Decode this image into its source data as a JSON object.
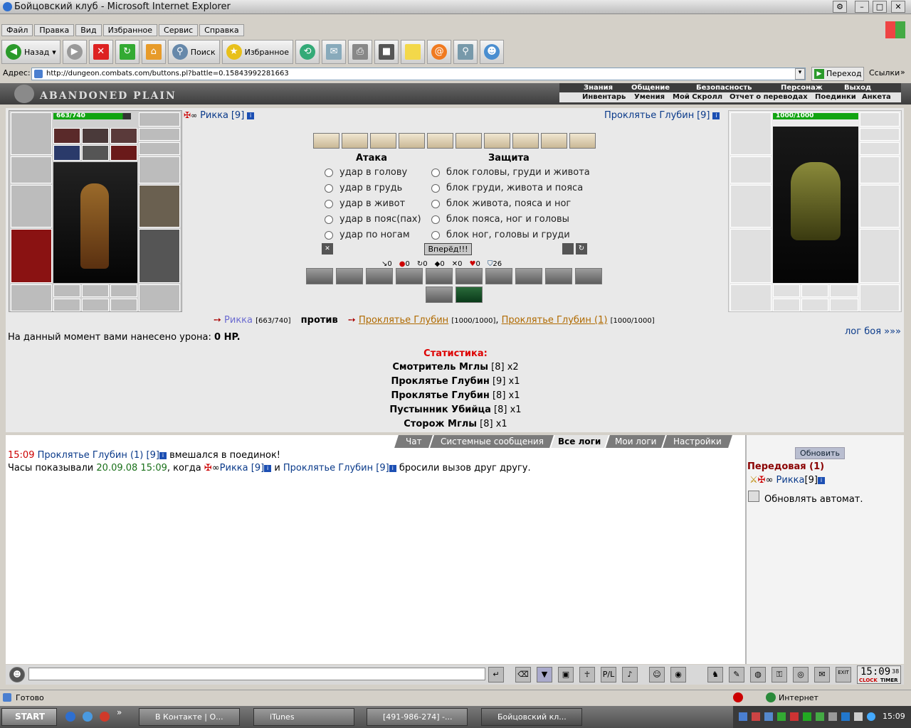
{
  "window": {
    "title": "Бойцовский клуб - Microsoft Internet Explorer"
  },
  "menu": [
    "Файл",
    "Правка",
    "Вид",
    "Избранное",
    "Сервис",
    "Справка"
  ],
  "toolbar": {
    "back": "Назад",
    "search": "Поиск",
    "favorites": "Избранное"
  },
  "address": {
    "label": "Адрес:",
    "url": "http://dungeon.combats.com/buttons.pl?battle=0.15843992281663",
    "go": "Переход",
    "links": "Ссылки"
  },
  "game_nav": {
    "location": "ABANDONED PLAIN",
    "top": [
      "Знания",
      "Общение",
      "Безопасность",
      "Персонаж",
      "Выход"
    ],
    "bottom": [
      "Инвентарь",
      "Умения",
      "Мой Скролл",
      "Отчет о переводах",
      "Поединки",
      "Анкета"
    ]
  },
  "player": {
    "name": "Рикка",
    "level": "[9]",
    "hp": "663/740",
    "hp_fraction": 0.896
  },
  "enemy": {
    "name": "Проклятье Глубин",
    "level": "[9]",
    "hp": "1000/1000",
    "hp_fraction": 1.0
  },
  "combat": {
    "attack_title": "Атака",
    "defense_title": "Защита",
    "attacks": [
      "удар в голову",
      "удар в грудь",
      "удар в живот",
      "удар в пояс(пах)",
      "удар по ногам"
    ],
    "defenses": [
      "блок головы, груди и живота",
      "блок груди, живота и пояса",
      "блок живота, пояса и ног",
      "блок пояса, ног и головы",
      "блок ног, головы и груди"
    ],
    "submit": "Вперёд!!!",
    "counters": [
      "0",
      "0",
      "0",
      "0",
      "0",
      "0",
      "26"
    ]
  },
  "versus": {
    "player": "Рикка",
    "player_hp": "[663/740]",
    "vs": "против",
    "enemy1": "Проклятье Глубин",
    "enemy1_hp": "[1000/1000]",
    "enemy2": "Проклятье Глубин (1)",
    "enemy2_hp": "[1000/1000]"
  },
  "damage": {
    "label": "На данный момент вами нанесено урона:",
    "value": "0 HP."
  },
  "battle_log_link": "лог боя »»»",
  "stats": {
    "title": "Статистика:",
    "rows": [
      {
        "name": "Смотритель Мглы",
        "level": "[8]",
        "count": "x2"
      },
      {
        "name": "Проклятье Глубин",
        "level": "[9]",
        "count": "x1"
      },
      {
        "name": "Проклятье Глубин",
        "level": "[8]",
        "count": "x1"
      },
      {
        "name": "Пустынник Убийца",
        "level": "[8]",
        "count": "x1"
      },
      {
        "name": "Сторож Мглы",
        "level": "[8]",
        "count": "x1"
      }
    ]
  },
  "tabs": [
    "Чат",
    "Системные сообщения",
    "Все логи",
    "Мои логи",
    "Настройки"
  ],
  "log": {
    "l1_time": "15:09",
    "l1_name": "Проклятье Глубин (1) [9]",
    "l1_text": "вмешался в поединок!",
    "l2_prefix": "Часы показывали",
    "l2_date": "20.09.08 15:09",
    "l2_when": ", когда",
    "l2_p1": "Рикка [9]",
    "l2_and": "и",
    "l2_p2": "Проклятье Глубин [9]",
    "l2_end": "бросили вызов друг другу."
  },
  "side": {
    "refresh": "Обновить",
    "room": "Передовая (1)",
    "user": "Рикка",
    "user_level": "[9]",
    "auto": "Обновлять автомат."
  },
  "clock": {
    "time": "15:09",
    "sec": "38",
    "clock_label": "CLOCK",
    "timer_label": "TIMER",
    "exit": "EXIT"
  },
  "status": {
    "ready": "Готово",
    "zone": "Интернет"
  },
  "taskbar": {
    "start": "START",
    "tasks": [
      "В Контакте | О...",
      "iTunes",
      "[491-986-274] -...",
      "Бойцовский кл..."
    ],
    "time": "15:09"
  }
}
